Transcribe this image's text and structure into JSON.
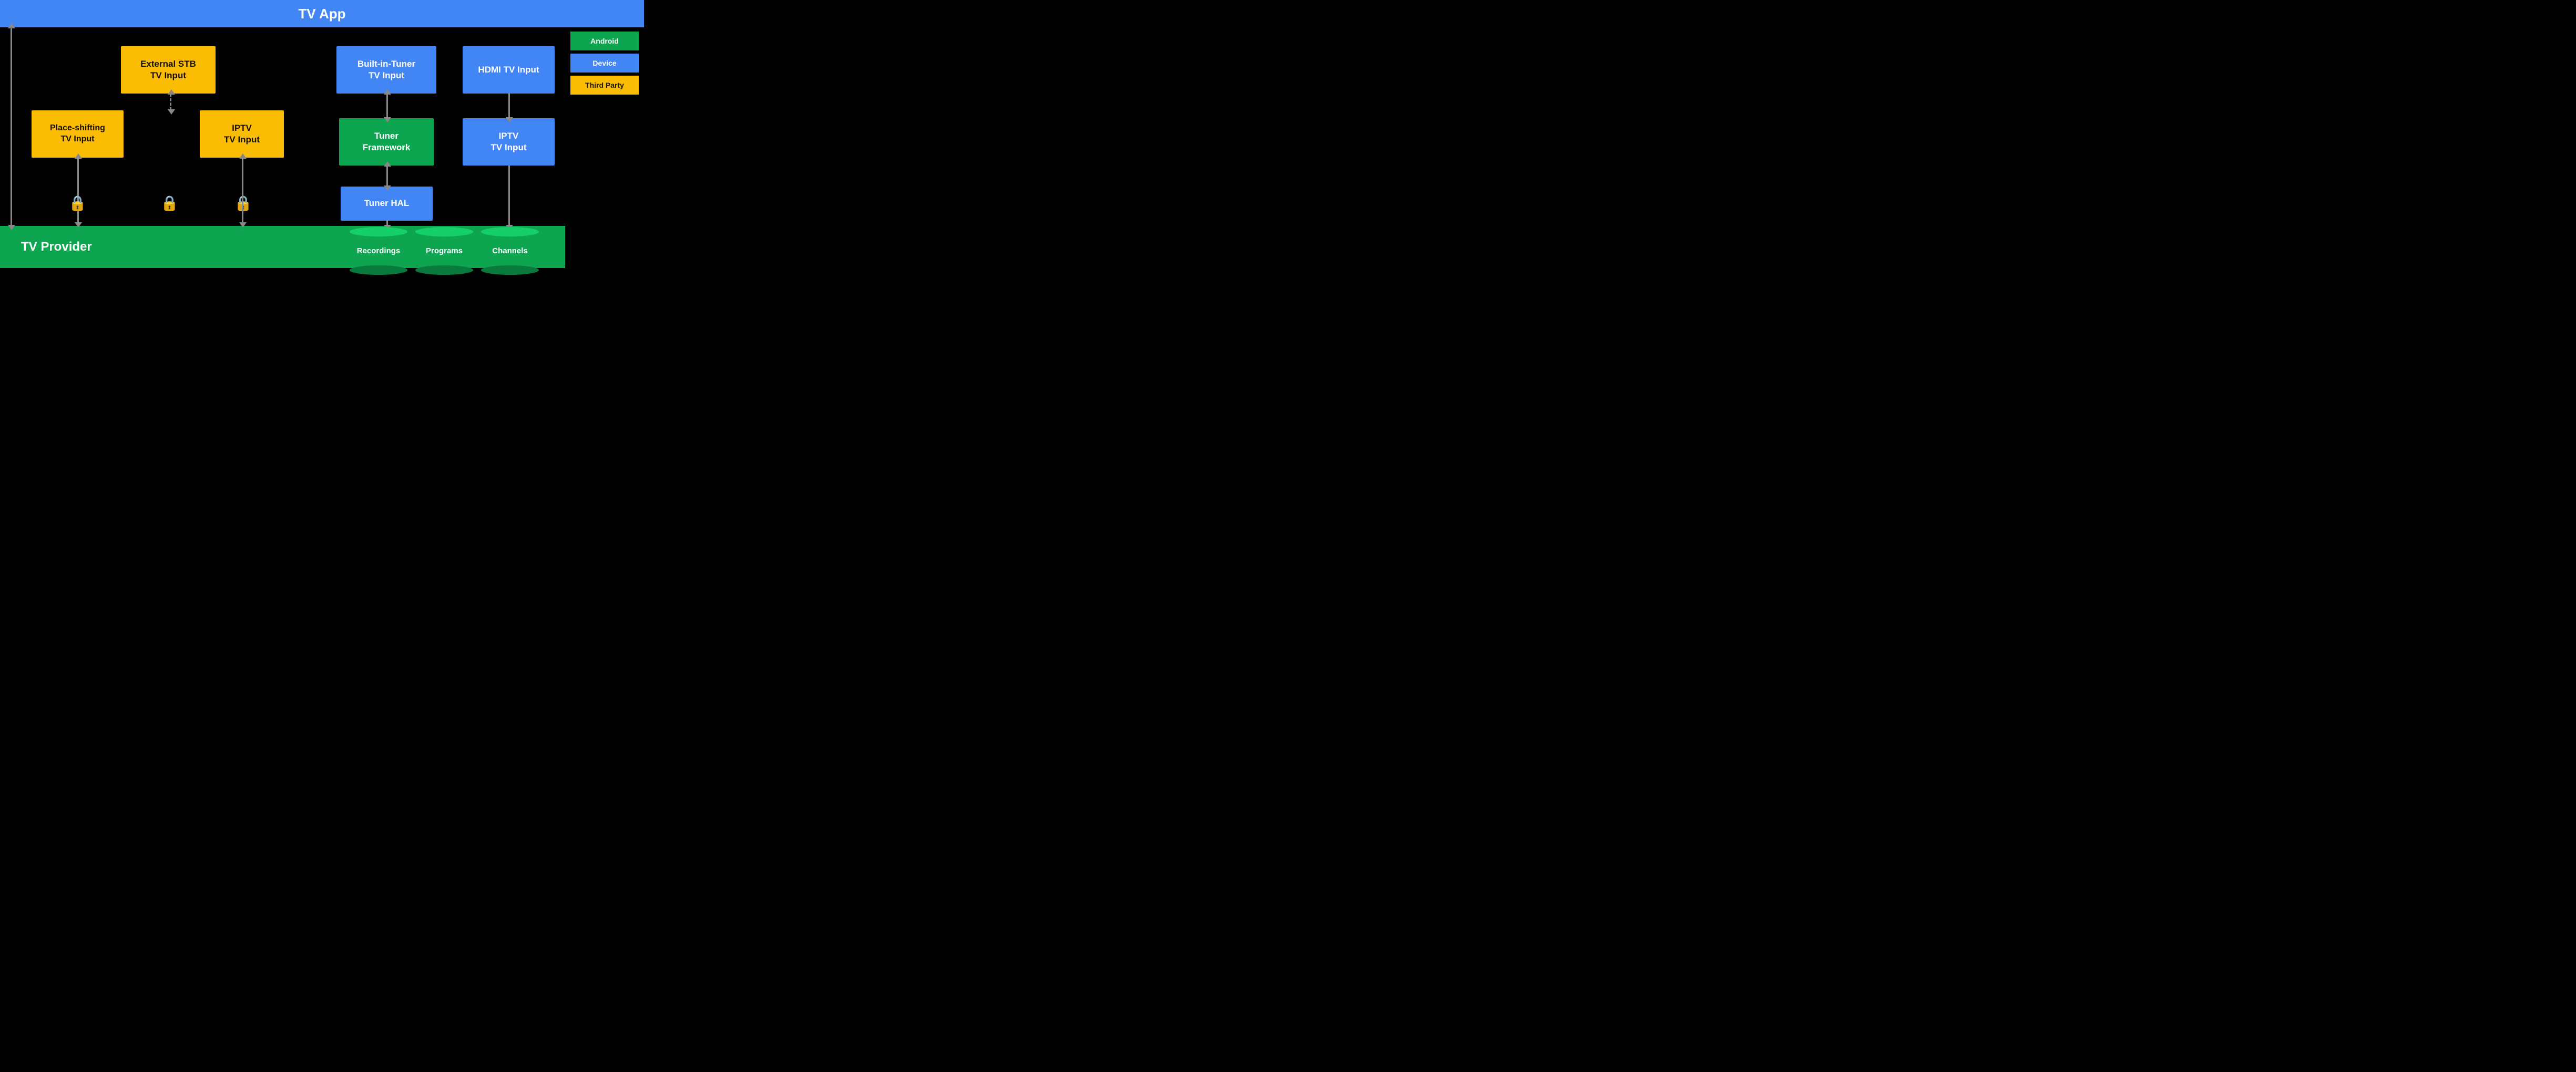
{
  "header": {
    "title": "TV App"
  },
  "footer": {
    "title": "TV Provider"
  },
  "legend": {
    "android": "Android",
    "device": "Device",
    "thirdParty": "Third Party"
  },
  "boxes": {
    "externalSTB": "External STB\nTV Input",
    "placeShifting": "Place-shifting\nTV Input",
    "iptvLeft": "IPTV\nTV Input",
    "builtInTuner": "Built-in-Tuner\nTV Input",
    "tunerFramework": "Tuner\nFramework",
    "tunerHAL": "Tuner HAL",
    "hdmiTVInput": "HDMI TV Input",
    "iptvRight": "IPTV\nTV Input"
  },
  "cylinders": {
    "recordings": "Recordings",
    "programs": "Programs",
    "channels": "Channels"
  }
}
